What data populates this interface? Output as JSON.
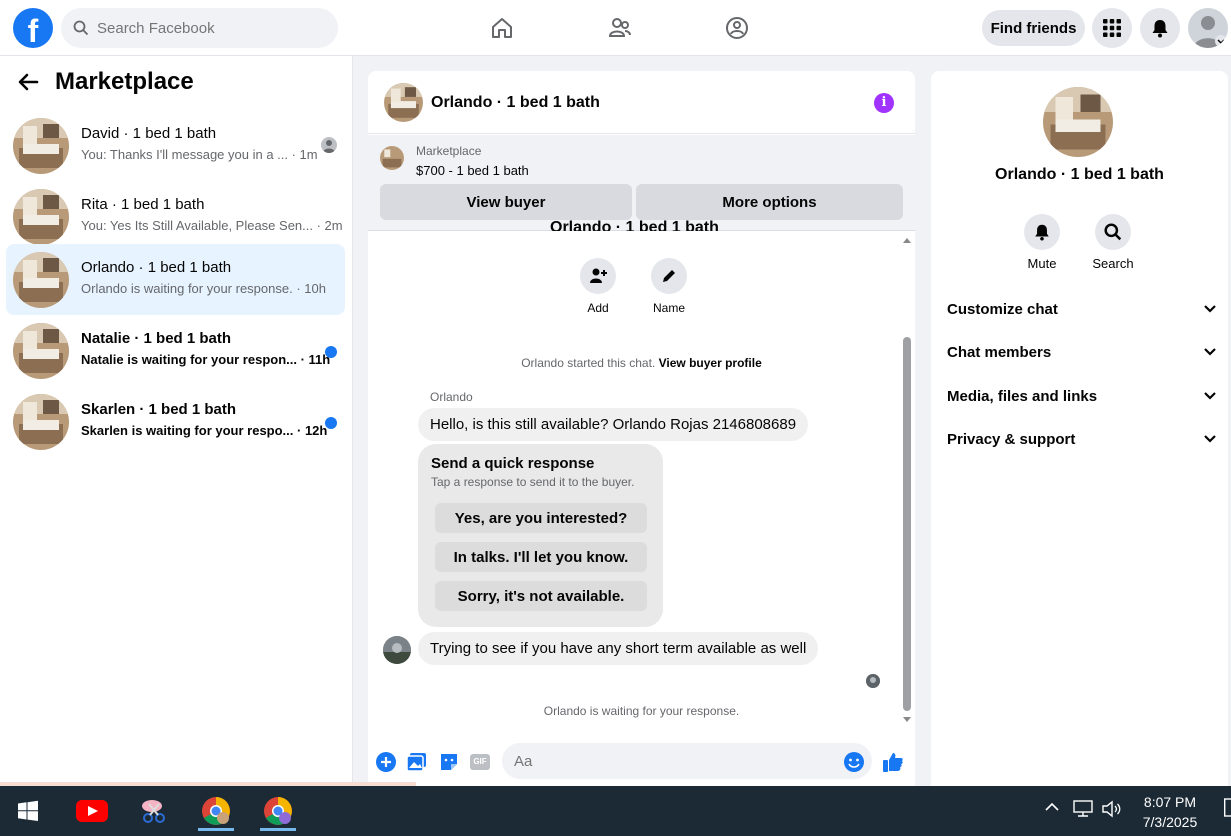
{
  "topbar": {
    "logo": "f",
    "search_placeholder": "Search Facebook",
    "find_friends": "Find friends"
  },
  "marketplace": {
    "title": "Marketplace",
    "conversations": [
      {
        "name": "David · 1 bed 1 bath",
        "preview": "You: Thanks I'll message you in a ... · 1m",
        "state": "read"
      },
      {
        "name": "Rita · 1 bed 1 bath",
        "preview": "You: Yes Its Still Available, Please Sen... · 2m",
        "state": "read"
      },
      {
        "name": "Orlando · 1 bed 1 bath",
        "preview": "Orlando is waiting for your response. · 10h",
        "state": "active"
      },
      {
        "name": "Natalie · 1 bed 1 bath",
        "preview": "Natalie is waiting for your respon... · 11h",
        "state": "unread"
      },
      {
        "name": "Skarlen · 1 bed 1 bath",
        "preview": "Skarlen is waiting for your respo... · 12h",
        "state": "unread"
      }
    ]
  },
  "chat": {
    "title": "Orlando · 1 bed 1 bath",
    "listing": {
      "label": "Marketplace",
      "price_title": "$700 - 1 bed 1 bath",
      "view_buyer": "View buyer",
      "more_options": "More options"
    },
    "cut_title": "Orlando · 1 bed 1 bath",
    "actions": {
      "add": "Add",
      "name": "Name"
    },
    "started_text": "Orlando started this chat.",
    "view_profile": "View buyer profile",
    "sender": "Orlando",
    "message1": "Hello, is this still available? Orlando Rojas 2146808689",
    "quick": {
      "heading": "Send a quick response",
      "sub": "Tap a response to send it to the buyer.",
      "options": [
        "Yes, are you interested?",
        "In talks. I'll let you know.",
        "Sorry, it's not available."
      ]
    },
    "message2": "Trying to see if you have any short term available as well",
    "waiting": "Orlando is waiting for your response.",
    "composer_placeholder": "Aa",
    "composer_gif": "GIF"
  },
  "details": {
    "title": "Orlando · 1 bed 1 bath",
    "mute": "Mute",
    "search": "Search",
    "sections": [
      "Customize chat",
      "Chat members",
      "Media, files and links",
      "Privacy & support"
    ]
  },
  "taskbar": {
    "time": "8:07 PM",
    "date": "7/3/2025"
  },
  "colors": {
    "brand": "#1877f2",
    "info": "#a033ff",
    "taskbar": "#1c2a35"
  }
}
